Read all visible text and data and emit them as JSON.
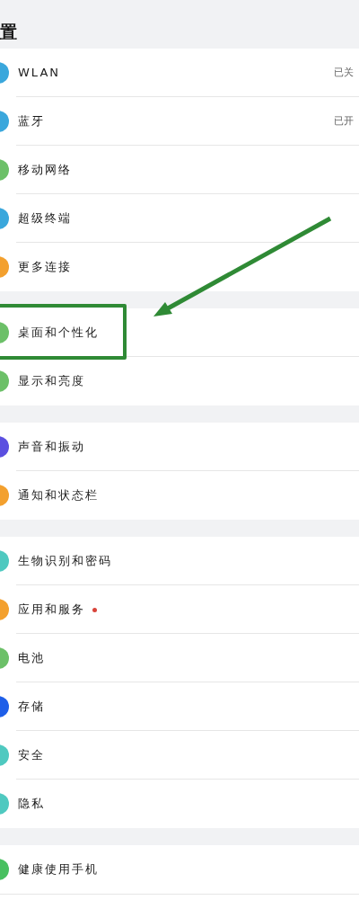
{
  "title": "置",
  "groups": [
    {
      "items": [
        {
          "label": "WLAN",
          "value": "已关",
          "color": "#3aa7dc"
        },
        {
          "label": "蓝牙",
          "value": "已开",
          "color": "#3aa7dc"
        },
        {
          "label": "移动网络",
          "color": "#6cc068"
        },
        {
          "label": "超级终端",
          "color": "#3aa7dc"
        },
        {
          "label": "更多连接",
          "color": "#f3a02e"
        }
      ]
    },
    {
      "items": [
        {
          "label": "桌面和个性化",
          "color": "#6cc068",
          "highlighted": true
        },
        {
          "label": "显示和亮度",
          "color": "#6cc068"
        }
      ]
    },
    {
      "items": [
        {
          "label": "声音和振动",
          "color": "#5b4fe0"
        },
        {
          "label": "通知和状态栏",
          "color": "#f3a02e"
        }
      ]
    },
    {
      "items": [
        {
          "label": "生物识别和密码",
          "color": "#4fc9c0"
        },
        {
          "label": "应用和服务",
          "color": "#f3a02e",
          "notification_dot": true
        },
        {
          "label": "电池",
          "color": "#6cc068"
        },
        {
          "label": "存储",
          "color": "#1e5ee8"
        },
        {
          "label": "安全",
          "color": "#4fc9c0"
        },
        {
          "label": "隐私",
          "color": "#4fc9c0"
        }
      ]
    },
    {
      "items": [
        {
          "label": "健康使用手机",
          "color": "#48c060"
        }
      ]
    }
  ]
}
